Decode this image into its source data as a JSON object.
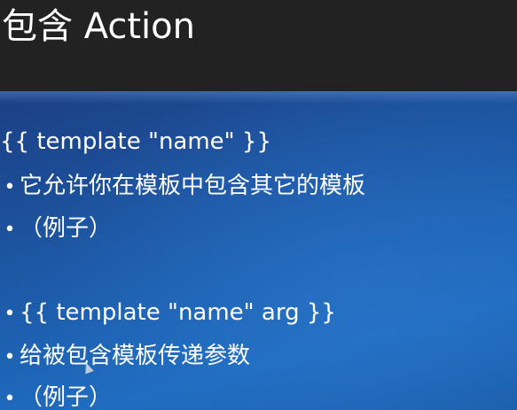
{
  "slide": {
    "title": "包含 Action",
    "lines": [
      {
        "bullet": "",
        "text": "{{ template \"name\" }}"
      },
      {
        "bullet": "•",
        "text": "它允许你在模板中包含其它的模板"
      },
      {
        "bullet": "•",
        "text": "（例子）"
      },
      {
        "bullet": "•",
        "text": "{{ template \"name\" arg }}"
      },
      {
        "bullet": "•",
        "text": "给被包含模板传递参数"
      },
      {
        "bullet": "•",
        "text": "（例子）"
      }
    ]
  },
  "colors": {
    "title_bar": "#222222",
    "content_blue": "#1d5aa8",
    "text": "#ffffff"
  }
}
